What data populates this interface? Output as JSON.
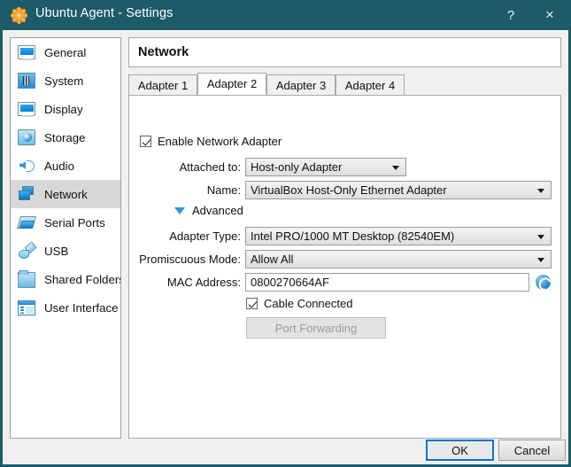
{
  "window": {
    "title": "Ubuntu Agent - Settings",
    "app_icon": "virtualbox-gear-icon",
    "titlebar_color": "#1d5b68",
    "help_label": "?",
    "close_label": "×"
  },
  "sidebar": {
    "items": [
      {
        "label": "General",
        "icon": "monitor-icon",
        "selected": false
      },
      {
        "label": "System",
        "icon": "cpu-chip-icon",
        "selected": false
      },
      {
        "label": "Display",
        "icon": "display-icon",
        "selected": false
      },
      {
        "label": "Storage",
        "icon": "hard-disk-icon",
        "selected": false
      },
      {
        "label": "Audio",
        "icon": "speaker-icon",
        "selected": false
      },
      {
        "label": "Network",
        "icon": "network-cards-icon",
        "selected": true
      },
      {
        "label": "Serial Ports",
        "icon": "serial-port-icon",
        "selected": false
      },
      {
        "label": "USB",
        "icon": "usb-plug-icon",
        "selected": false
      },
      {
        "label": "Shared Folders",
        "icon": "folder-icon",
        "selected": false
      },
      {
        "label": "User Interface",
        "icon": "ui-window-icon",
        "selected": false
      }
    ]
  },
  "pane": {
    "title": "Network",
    "tabs": [
      {
        "label": "Adapter 1",
        "active": false
      },
      {
        "label": "Adapter 2",
        "active": true
      },
      {
        "label": "Adapter 3",
        "active": false
      },
      {
        "label": "Adapter 4",
        "active": false
      }
    ]
  },
  "form": {
    "enable_adapter": {
      "label": "Enable Network Adapter",
      "checked": true
    },
    "attached_to": {
      "label": "Attached to:",
      "value": "Host-only Adapter"
    },
    "name": {
      "label": "Name:",
      "value": "VirtualBox Host-Only Ethernet Adapter"
    },
    "advanced": {
      "label": "Advanced",
      "expanded": true,
      "icon": "triangle-down-icon"
    },
    "adapter_type": {
      "label": "Adapter Type:",
      "value": "Intel PRO/1000 MT Desktop (82540EM)"
    },
    "promiscuous": {
      "label": "Promiscuous Mode:",
      "value": "Allow All"
    },
    "mac_address": {
      "label": "MAC Address:",
      "value": "0800270664AF",
      "refresh_icon": "refresh-icon"
    },
    "cable_connected": {
      "label": "Cable Connected",
      "checked": true
    },
    "port_forwarding": {
      "label": "Port Forwarding",
      "enabled": false
    }
  },
  "footer": {
    "ok_label": "OK",
    "cancel_label": "Cancel",
    "focus_color": "#0a74d4"
  }
}
